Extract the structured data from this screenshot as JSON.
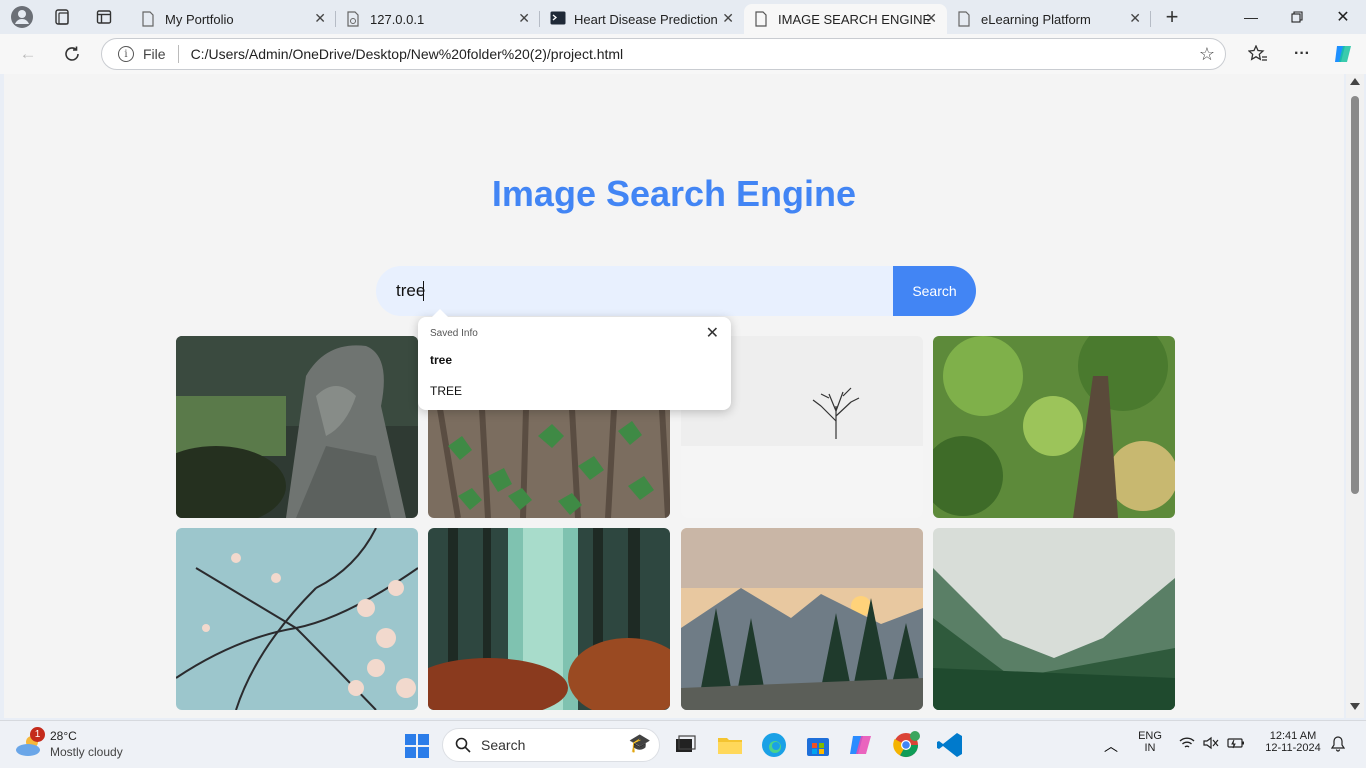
{
  "browser": {
    "tabs": [
      {
        "title": "My Portfolio",
        "active": false
      },
      {
        "title": "127.0.0.1",
        "active": false
      },
      {
        "title": "Heart Disease Prediction",
        "active": false
      },
      {
        "title": "IMAGE SEARCH ENGINE",
        "active": true
      },
      {
        "title": "eLearning Platform",
        "active": false
      }
    ],
    "address": {
      "scheme_label": "File",
      "url": "C:/Users/Admin/OneDrive/Desktop/New%20folder%20(2)/project.html"
    }
  },
  "page": {
    "title": "Image Search Engine",
    "search": {
      "value": "tree",
      "button_label": "Search"
    },
    "autofill": {
      "title": "Saved Info",
      "items": [
        "tree",
        "TREE"
      ]
    },
    "images": [
      "tree-trunk-rock",
      "ivy-on-bark",
      "lone-tree-snow",
      "tree-canopy-sunlight",
      "blossom-branches-sky",
      "misty-forest",
      "mountain-sunset-pines",
      "foggy-forest-valley"
    ]
  },
  "taskbar": {
    "weather": {
      "temp": "28°C",
      "condition": "Mostly cloudy",
      "badge": "1"
    },
    "search_label": "Search",
    "lang": {
      "line1": "ENG",
      "line2": "IN"
    },
    "clock": {
      "time": "12:41 AM",
      "date": "12-11-2024"
    }
  }
}
